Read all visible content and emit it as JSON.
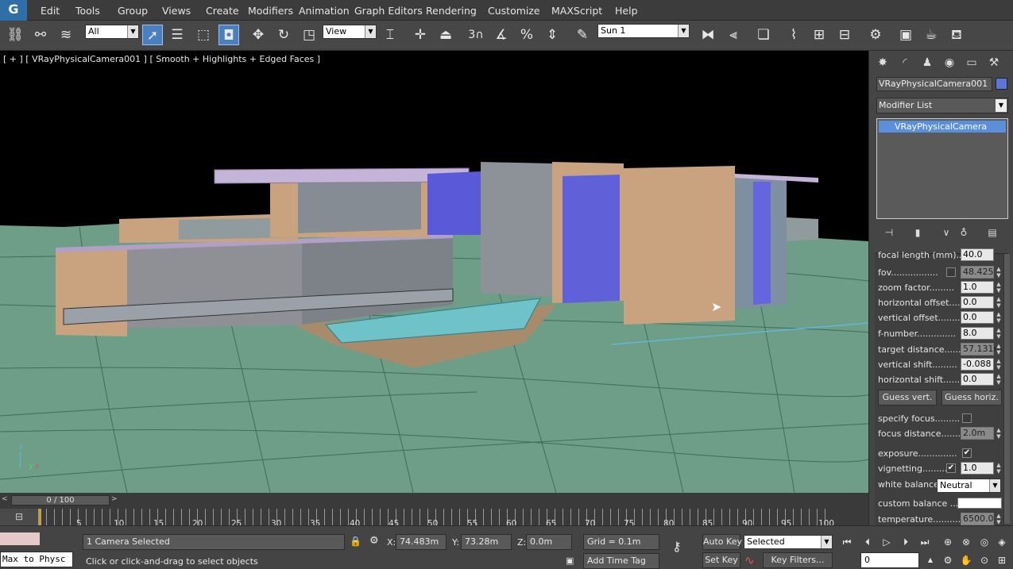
{
  "app": {
    "logo": "G"
  },
  "menu": [
    "Edit",
    "Tools",
    "Group",
    "Views",
    "Create",
    "Modifiers",
    "Animation",
    "Graph Editors",
    "Rendering",
    "Customize",
    "MAXScript",
    "Help"
  ],
  "toolbar": {
    "selection_filter": "All",
    "ref_coord": "View",
    "named_selection": "Sun 1",
    "snaps_label": "3",
    "icons": [
      "link-icon",
      "unlink-icon",
      "bind-spacewarp-icon",
      "select-object-icon",
      "select-by-name-icon",
      "rect-region-icon",
      "window-crossing-icon",
      "move-icon",
      "rotate-icon",
      "scale-icon",
      "pivot-icon",
      "manipulate-icon",
      "keyboard-shortcut-icon",
      "snap-icon",
      "angle-snap-icon",
      "percent-snap-icon",
      "spinner-snap-icon",
      "edit-named-sets-icon",
      "mirror-icon",
      "align-icon",
      "layer-manager-icon",
      "curve-editor-icon",
      "schematic-icon",
      "material-editor-icon",
      "render-setup-icon",
      "rendered-frame-icon",
      "render-icon",
      "teapot-icon"
    ]
  },
  "viewport": {
    "label": "[ + ] [ VRayPhysicalCamera001 ] [ Smooth + Highlights + Edged Faces ]",
    "axis": {
      "z": "z",
      "x": "x",
      "y": "y"
    }
  },
  "command_panel": {
    "object_name": "VRayPhysicalCamera001",
    "object_color": "#5b76d6",
    "modifier_list": "Modifier List",
    "stack_item": "VRayPhysicalCamera",
    "params": {
      "cut_row": {
        "label": "focal length (mm)....",
        "value": "40.0"
      },
      "fov": {
        "label": "fov.................",
        "value": "48.425"
      },
      "zoom_factor": {
        "label": "zoom factor.........",
        "value": "1.0"
      },
      "horizontal_offset": {
        "label": "horizontal offset.....",
        "value": "0.0"
      },
      "vertical_offset": {
        "label": "vertical offset........",
        "value": "0.0"
      },
      "f_number": {
        "label": "f-number..............",
        "value": "8.0"
      },
      "target_distance": {
        "label": "target distance.......",
        "value": "57.131m"
      },
      "vertical_shift": {
        "label": "vertical shift.........",
        "value": "-0.088"
      },
      "horizontal_shift": {
        "label": "horizontal shift......",
        "value": "0.0"
      },
      "guess_vert": "Guess vert.",
      "guess_horiz": "Guess horiz.",
      "specify_focus": {
        "label": "specify focus.........",
        "checked": false
      },
      "focus_distance": {
        "label": "focus distance.......",
        "value": "2.0m"
      },
      "exposure": {
        "label": "exposure..............",
        "checked": true
      },
      "vignetting": {
        "label": "vignetting...........",
        "checked": true,
        "value": "1.0"
      },
      "white_balance": {
        "label": "white balance",
        "value": "Neutral"
      },
      "custom_balance": {
        "label": "custom balance .....",
        "color": "#ffffff"
      },
      "temperature": {
        "label": "temperature..........",
        "value": "6500.0"
      }
    }
  },
  "timeline": {
    "slider": "0 / 100",
    "ticks": [
      "5",
      "10",
      "15",
      "20",
      "25",
      "30",
      "35",
      "40",
      "45",
      "50",
      "55",
      "60",
      "65",
      "70",
      "75",
      "80",
      "85",
      "90",
      "95",
      "100"
    ]
  },
  "status": {
    "script_listener": "Max to Physc",
    "selection": "1 Camera Selected",
    "prompt": "Click or click-and-drag to select objects",
    "x_label": "X:",
    "x": "74.483m",
    "y_label": "Y:",
    "y": "73.28m",
    "z_label": "Z:",
    "z": "0.0m",
    "grid": "Grid = 0.1m",
    "add_time_tag": "Add Time Tag",
    "auto_key": "Auto Key",
    "set_key": "Set Key",
    "key_mode": "Selected",
    "key_filters": "Key Filters...",
    "frame": "0"
  }
}
